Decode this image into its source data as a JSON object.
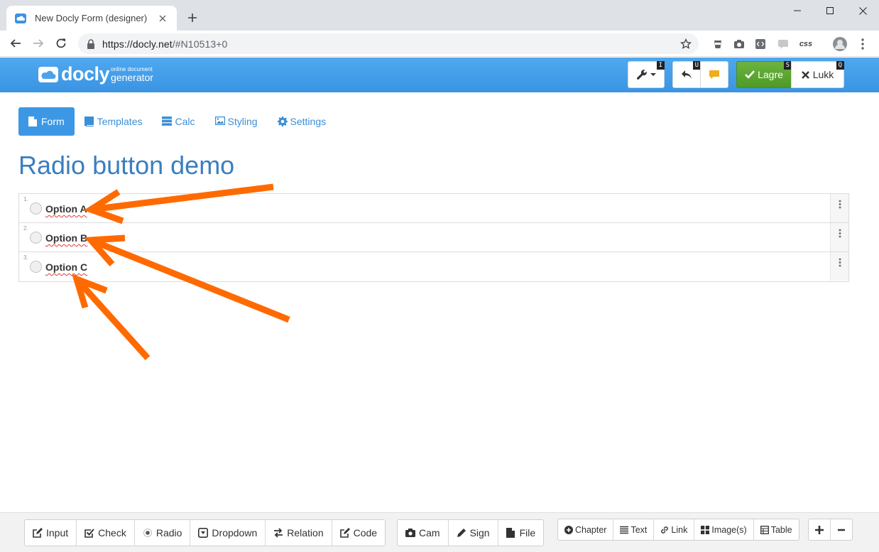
{
  "browser": {
    "tab_title": "New Docly Form (designer)",
    "url_host": "https://docly.net",
    "url_path": "/#N10513+0",
    "ext_css_label": "css"
  },
  "app": {
    "logo_text": "docly",
    "logo_sub_top": "online document",
    "logo_sub_bottom": "generator",
    "shortcuts": {
      "tools": "I",
      "undo": "U",
      "save": "S",
      "close": "Q"
    },
    "save_label": "Lagre",
    "close_label": "Lukk"
  },
  "nav_tabs": [
    {
      "label": "Form",
      "icon": "file-icon",
      "active": true
    },
    {
      "label": "Templates",
      "icon": "book-icon"
    },
    {
      "label": "Calc",
      "icon": "server-icon"
    },
    {
      "label": "Styling",
      "icon": "image-icon"
    },
    {
      "label": "Settings",
      "icon": "gear-icon"
    }
  ],
  "form": {
    "title": "Radio button demo",
    "options": [
      {
        "num": "1.",
        "label": "Option A"
      },
      {
        "num": "2.",
        "label": "Option B"
      },
      {
        "num": "3.",
        "label": "Option C"
      }
    ]
  },
  "bottom_toolbar": {
    "fields": [
      {
        "label": "Input",
        "icon": "edit-icon"
      },
      {
        "label": "Check",
        "icon": "check-square-icon"
      },
      {
        "label": "Radio",
        "icon": "radio-dot-icon"
      },
      {
        "label": "Dropdown",
        "icon": "dropdown-icon"
      },
      {
        "label": "Relation",
        "icon": "exchange-icon"
      },
      {
        "label": "Code",
        "icon": "code-edit-icon"
      }
    ],
    "media": [
      {
        "label": "Cam",
        "icon": "camera-icon"
      },
      {
        "label": "Sign",
        "icon": "pencil-icon"
      },
      {
        "label": "File",
        "icon": "file-icon"
      }
    ],
    "layout": [
      {
        "label": "Chapter",
        "icon": "plus-circle-icon"
      },
      {
        "label": "Text",
        "icon": "list-icon"
      },
      {
        "label": "Link",
        "icon": "link-icon"
      },
      {
        "label": "Image(s)",
        "icon": "grid-icon"
      },
      {
        "label": "Table",
        "icon": "table-icon"
      }
    ]
  },
  "colors": {
    "header_blue": "#3a94e3",
    "title_blue": "#3a7fbf",
    "save_green": "#5ba731",
    "arrow_orange": "#ff6a00"
  }
}
